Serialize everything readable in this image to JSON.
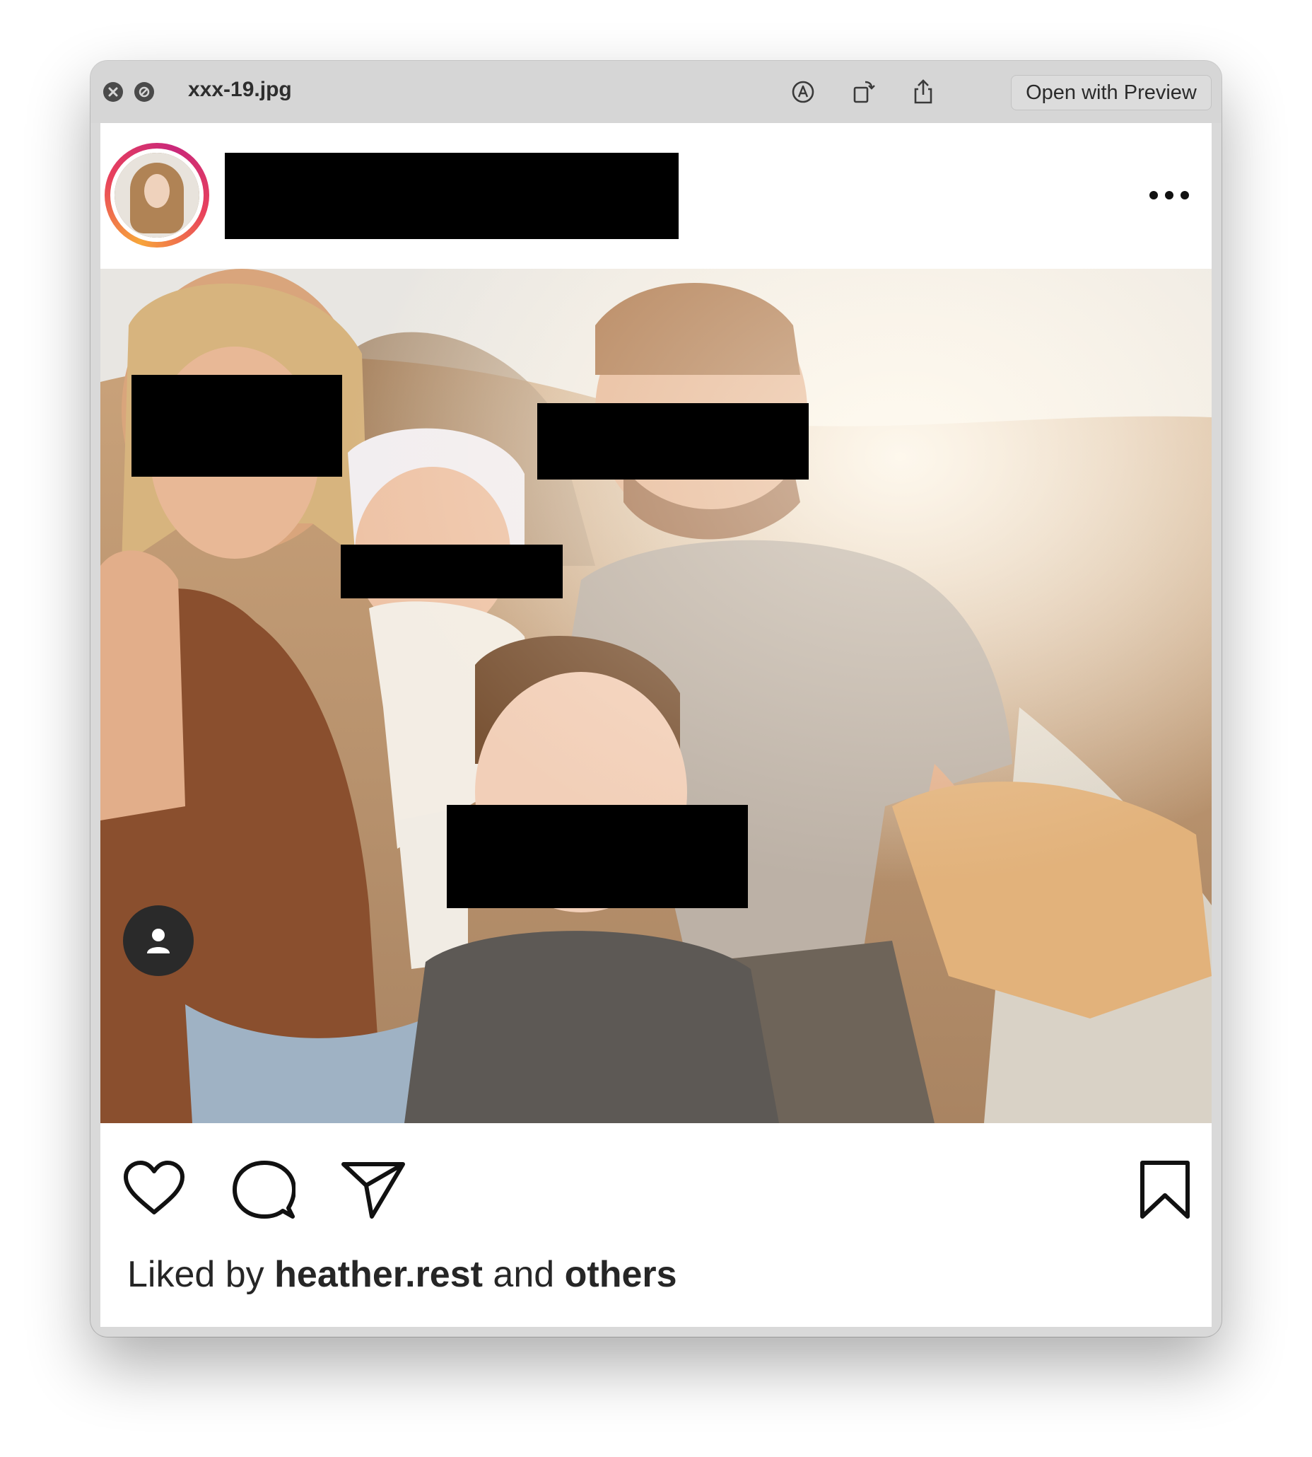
{
  "window": {
    "title": "xxx-19.jpg",
    "open_button_label": "Open with Preview"
  },
  "post": {
    "likes": {
      "prefix": "Liked by ",
      "user": "heather.rest",
      "middle": " and ",
      "suffix": "others"
    }
  },
  "icons": {
    "close": "close-icon",
    "block": "block-icon",
    "markup": "markup-icon",
    "rotate": "rotate-icon",
    "share": "share-icon",
    "more": "more-options-icon",
    "tag": "person-tag-icon",
    "like": "heart-icon",
    "comment": "comment-icon",
    "send": "send-icon",
    "save": "bookmark-icon"
  }
}
